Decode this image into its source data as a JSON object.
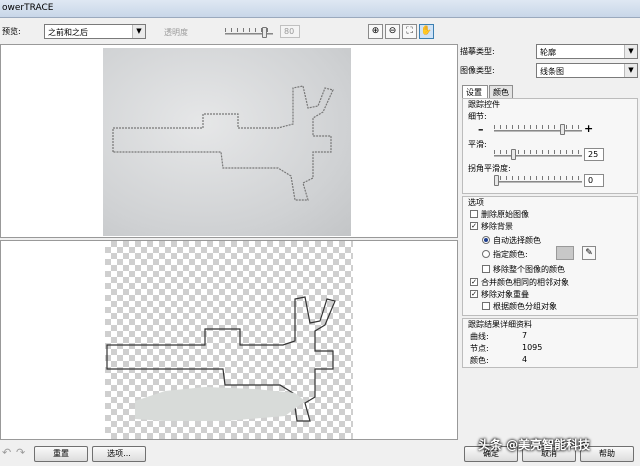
{
  "window": {
    "title": "owerTRACE"
  },
  "toolbar": {
    "preview_label": "预览:",
    "preview_select": "之前和之后",
    "transparency_label": "透明度",
    "transparency_value": "80"
  },
  "right": {
    "trace_type_label": "描摹类型:",
    "trace_type_value": "轮廓",
    "image_type_label": "图像类型:",
    "image_type_value": "线条图",
    "tabs": [
      "设置",
      "颜色"
    ],
    "tracing_controls_title": "跟踪控件",
    "detail_label": "细节:",
    "minus_sign": "–",
    "plus_sign": "+",
    "smoothing_label": "平滑:",
    "smoothing_value": "25",
    "corner_label": "拐角平滑度:",
    "corner_value": "0",
    "options_title": "选项",
    "opt_delete_original": "删除原始图像",
    "opt_remove_background": "移除背景",
    "opt_auto_color": "自动选择颜色",
    "opt_specify_color": "指定颜色:",
    "opt_remove_whole": "移除整个图像的颜色",
    "opt_merge_adjacent": "合并颜色相同的相邻对象",
    "opt_remove_overlap": "移除对象重叠",
    "opt_group_by_color": "根据颜色分组对象",
    "results_title": "跟踪结果详细资料",
    "curves_label": "曲线:",
    "curves_value": "7",
    "nodes_label": "节点:",
    "nodes_value": "1095",
    "colors_label": "颜色:",
    "colors_value": "4"
  },
  "bottom": {
    "undo_icon": "↶",
    "redo_icon": "↷",
    "reset_label": "重置",
    "options_label": "选项...",
    "ok_label": "确定",
    "cancel_label": "取消",
    "help_label": "帮助"
  },
  "watermark": "头条 @美亮智能科技",
  "icons": {
    "zoom_in": "zoom-in-icon",
    "zoom_out": "zoom-out-icon",
    "fit": "fit-icon",
    "pan": "hand-icon",
    "eyedropper": "eyedropper-icon"
  }
}
